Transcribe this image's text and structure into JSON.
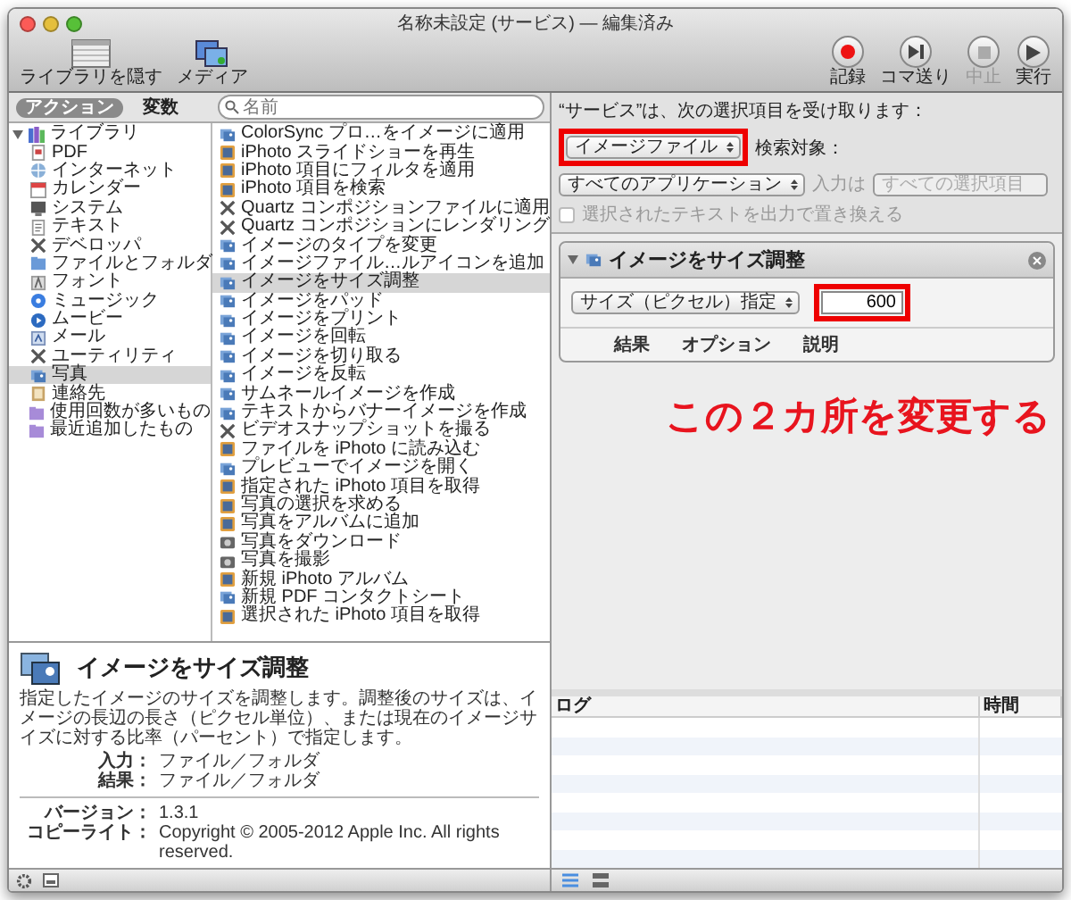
{
  "window": {
    "title": "名称未設定 (サービス) — 編集済み"
  },
  "toolbar_left": [
    {
      "label": "ライブラリを隠す",
      "kind": "library"
    },
    {
      "label": "メディア",
      "kind": "media"
    }
  ],
  "toolbar_right": [
    {
      "label": "記録",
      "kind": "record",
      "disabled": false
    },
    {
      "label": "コマ送り",
      "kind": "step",
      "disabled": false
    },
    {
      "label": "中止",
      "kind": "stop",
      "disabled": true
    },
    {
      "label": "実行",
      "kind": "run",
      "disabled": false
    }
  ],
  "library_tabs": [
    {
      "label": "アクション",
      "selected": true
    },
    {
      "label": "変数",
      "selected": false
    }
  ],
  "search": {
    "placeholder": "名前"
  },
  "categories": [
    {
      "label": "ライブラリ",
      "kind": "library",
      "expanded": true,
      "selected": false,
      "children": [
        {
          "label": "PDF",
          "kind": "pdf",
          "selected": false
        },
        {
          "label": "インターネット",
          "kind": "globe",
          "selected": false
        },
        {
          "label": "カレンダー",
          "kind": "calendar",
          "selected": false
        },
        {
          "label": "システム",
          "kind": "system",
          "selected": false
        },
        {
          "label": "テキスト",
          "kind": "text",
          "selected": false
        },
        {
          "label": "デベロッパ",
          "kind": "tool",
          "selected": false
        },
        {
          "label": "ファイルとフォルダ",
          "kind": "finder",
          "selected": false
        },
        {
          "label": "フォント",
          "kind": "font",
          "selected": false
        },
        {
          "label": "ミュージック",
          "kind": "music",
          "selected": false
        },
        {
          "label": "ムービー",
          "kind": "movie",
          "selected": false
        },
        {
          "label": "メール",
          "kind": "mail",
          "selected": false
        },
        {
          "label": "ユーティリティ",
          "kind": "tool",
          "selected": false
        },
        {
          "label": "写真",
          "kind": "image",
          "selected": true
        },
        {
          "label": "連絡先",
          "kind": "contacts",
          "selected": false
        }
      ]
    },
    {
      "label": "使用回数が多いもの",
      "kind": "smart",
      "selected": false
    },
    {
      "label": "最近追加したもの",
      "kind": "smart",
      "selected": false
    }
  ],
  "actions": [
    {
      "label": "ColorSync プロ…をイメージに適用",
      "kind": "image",
      "selected": false
    },
    {
      "label": "iPhoto スライドショーを再生",
      "kind": "iphoto",
      "selected": false
    },
    {
      "label": "iPhoto 項目にフィルタを適用",
      "kind": "iphoto",
      "selected": false
    },
    {
      "label": "iPhoto 項目を検索",
      "kind": "iphoto",
      "selected": false
    },
    {
      "label": "Quartz コンポジションファイルに適用",
      "kind": "tool",
      "selected": false
    },
    {
      "label": "Quartz コンポジションにレンダリング",
      "kind": "tool",
      "selected": false
    },
    {
      "label": "イメージのタイプを変更",
      "kind": "image",
      "selected": false
    },
    {
      "label": "イメージファイル…ルアイコンを追加",
      "kind": "image",
      "selected": false
    },
    {
      "label": "イメージをサイズ調整",
      "kind": "image",
      "selected": true
    },
    {
      "label": "イメージをパッド",
      "kind": "image",
      "selected": false
    },
    {
      "label": "イメージをプリント",
      "kind": "image",
      "selected": false
    },
    {
      "label": "イメージを回転",
      "kind": "image",
      "selected": false
    },
    {
      "label": "イメージを切り取る",
      "kind": "image",
      "selected": false
    },
    {
      "label": "イメージを反転",
      "kind": "image",
      "selected": false
    },
    {
      "label": "サムネールイメージを作成",
      "kind": "image",
      "selected": false
    },
    {
      "label": "テキストからバナーイメージを作成",
      "kind": "image",
      "selected": false
    },
    {
      "label": "ビデオスナップショットを撮る",
      "kind": "tool",
      "selected": false
    },
    {
      "label": "ファイルを iPhoto に読み込む",
      "kind": "iphoto",
      "selected": false
    },
    {
      "label": "プレビューでイメージを開く",
      "kind": "image",
      "selected": false
    },
    {
      "label": "指定された iPhoto 項目を取得",
      "kind": "iphoto",
      "selected": false
    },
    {
      "label": "写真の選択を求める",
      "kind": "iphoto",
      "selected": false
    },
    {
      "label": "写真をアルバムに追加",
      "kind": "iphoto",
      "selected": false
    },
    {
      "label": "写真をダウンロード",
      "kind": "camera",
      "selected": false
    },
    {
      "label": "写真を撮影",
      "kind": "camera",
      "selected": false
    },
    {
      "label": "新規 iPhoto アルバム",
      "kind": "iphoto",
      "selected": false
    },
    {
      "label": "新規 PDF コンタクトシート",
      "kind": "image",
      "selected": false
    },
    {
      "label": "選択された iPhoto 項目を取得",
      "kind": "iphoto",
      "selected": false
    }
  ],
  "description": {
    "title": "イメージをサイズ調整",
    "text": "指定したイメージのサイズを調整します。調整後のサイズは、イメージの長辺の長さ（ピクセル単位）、または現在のイメージサイズに対する比率（パーセント）で指定します。",
    "fields": [
      {
        "label": "入力：",
        "value": "ファイル／フォルダ"
      },
      {
        "label": "結果：",
        "value": "ファイル／フォルダ"
      }
    ],
    "info": [
      {
        "label": "バージョン：",
        "value": "1.3.1"
      },
      {
        "label": "コピーライト：",
        "value": "Copyright © 2005-2012 Apple Inc.  All rights reserved."
      }
    ]
  },
  "service_bar": {
    "receives_label": "“サービス”は、次の選択項目を受け取ります：",
    "receives_value": "イメージファイル",
    "receives_highlighted": true,
    "target_label": "検索対象：",
    "target_value": "すべてのアプリケーション",
    "input_label": "入力は",
    "input_value": "すべての選択項目",
    "input_disabled": true,
    "replace_label": "選択されたテキストを出力で置き換える",
    "replace_checked": false,
    "replace_disabled": true
  },
  "action_card": {
    "title": "イメージをサイズ調整",
    "expanded": true,
    "mode": "サイズ（ピクセル）指定",
    "size": "600",
    "size_highlighted": true,
    "tabs": [
      "結果",
      "オプション",
      "説明"
    ]
  },
  "annotation": "この２カ所を変更する",
  "log": {
    "columns": [
      "ログ",
      "時間"
    ]
  }
}
